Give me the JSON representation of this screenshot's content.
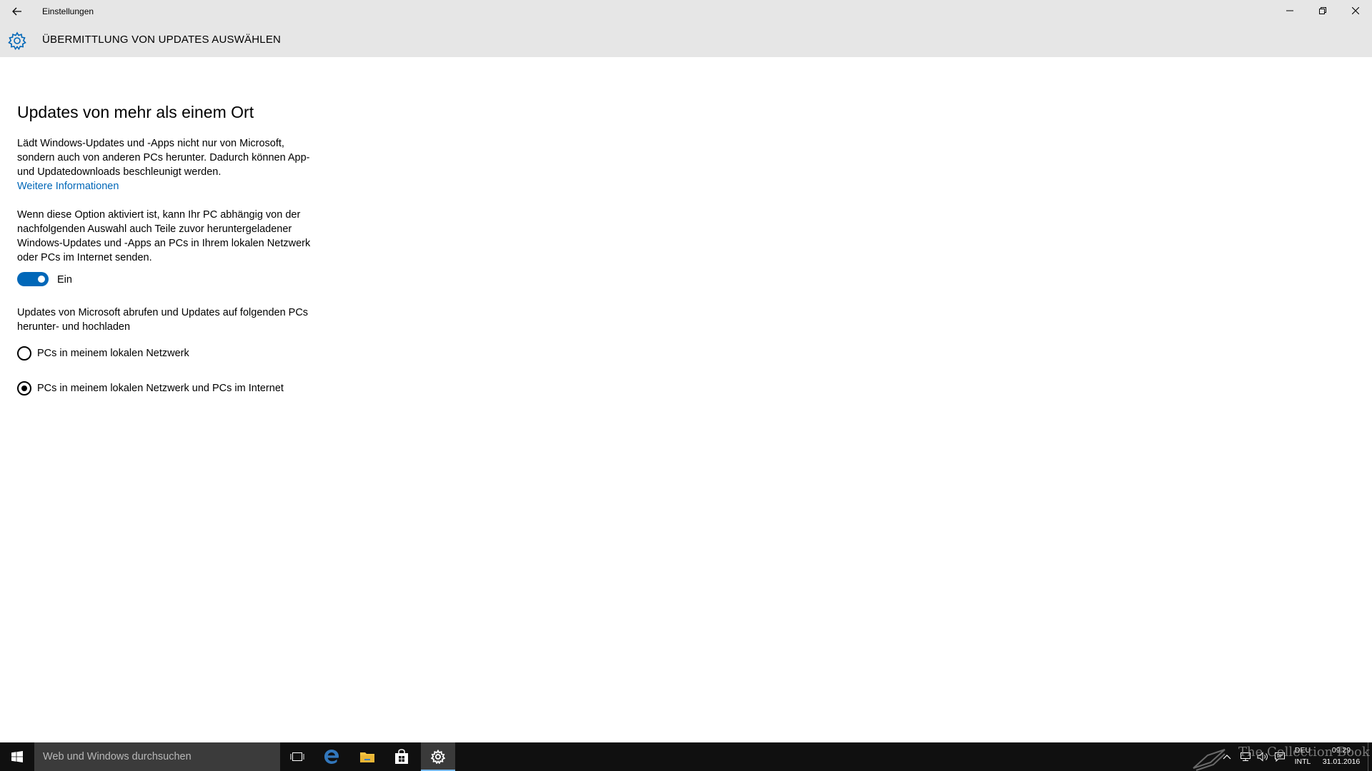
{
  "window": {
    "app_title": "Einstellungen",
    "page_title": "ÜBERMITTLUNG VON UPDATES AUSWÄHLEN",
    "controls": [
      "minimize-icon",
      "maximize-icon",
      "close-icon"
    ]
  },
  "content": {
    "section_title": "Updates von mehr als einem Ort",
    "description": "Lädt Windows-Updates und -Apps nicht nur von Microsoft, sondern auch von anderen PCs herunter. Dadurch können App- und Updatedownloads beschleunigt werden.",
    "link_label": "Weitere Informationen",
    "option_description": "Wenn diese Option aktiviert ist, kann Ihr PC abhängig von der nachfolgenden Auswahl auch Teile zuvor heruntergeladener Windows-Updates und -Apps an PCs in Ihrem lokalen Netzwerk oder PCs im Internet senden.",
    "toggle": {
      "label": "Ein",
      "on": true
    },
    "radio_group_label": "Updates von Microsoft abrufen und Updates auf folgenden PCs herunter- und hochladen",
    "radio_options": [
      {
        "label": "PCs in meinem lokalen Netzwerk",
        "selected": false
      },
      {
        "label": "PCs in meinem lokalen Netzwerk und PCs im Internet",
        "selected": true
      }
    ]
  },
  "taskbar": {
    "search_placeholder": "Web und Windows durchsuchen",
    "language_line1": "DEU",
    "language_line2": "INTL",
    "time": "09:29",
    "date": "31.01.2016",
    "watermark": "The Collection Book"
  },
  "colors": {
    "accent": "#0067b8",
    "header_bg": "#e6e6e6",
    "taskbar_bg": "#101010"
  }
}
